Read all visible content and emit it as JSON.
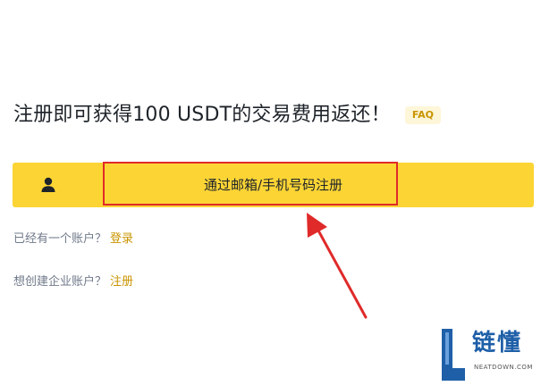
{
  "headline": {
    "text": "注册即可获得100 USDT的交易费用返还！",
    "faq_label": "FAQ"
  },
  "signup": {
    "label": "通过邮箱/手机号码注册",
    "icon": "user-icon"
  },
  "login_prompt": {
    "text": "已经有一个账户？",
    "link": "登录"
  },
  "enterprise_prompt": {
    "text": "想创建企业账户？",
    "link": "注册"
  },
  "annotation": {
    "highlight_color": "#e02a2a",
    "arrow_color": "#e02a2a"
  },
  "watermark": {
    "title": "链懂",
    "subtitle": "NEATDOWN.COM"
  },
  "colors": {
    "primary_yellow": "#fcd535",
    "link_gold": "#c99400",
    "text_dark": "#1e2329",
    "text_muted": "#707a8a"
  }
}
